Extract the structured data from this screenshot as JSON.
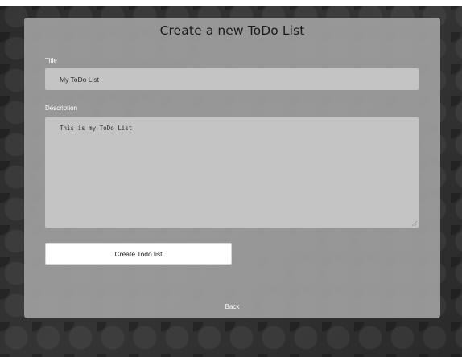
{
  "page": {
    "heading": "Create a new ToDo List"
  },
  "form": {
    "title_label": "Title",
    "title_value": "My ToDo List",
    "description_label": "Description",
    "description_value": "This is my ToDo List",
    "submit_label": "Create Todo list",
    "back_label": "Back"
  },
  "colors": {
    "card_background": "#a0a0a0",
    "field_background": "#c4c4c4",
    "page_background": "#2d2d2d",
    "button_background": "#ffffff"
  },
  "icons": {
    "textarea_resize": "resize-grip-icon"
  }
}
